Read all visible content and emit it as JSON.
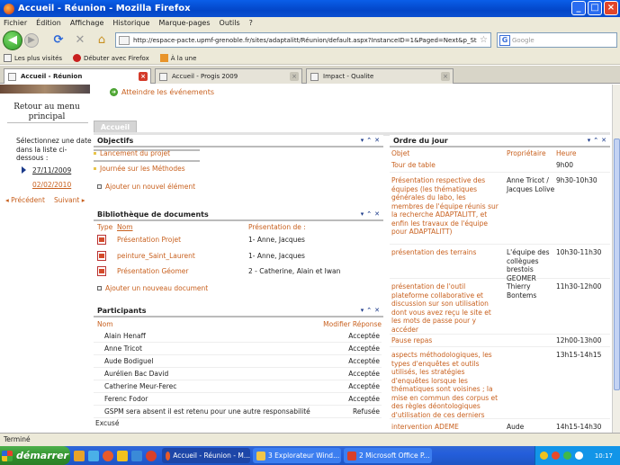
{
  "window": {
    "title": "Accueil - Réunion - Mozilla Firefox"
  },
  "menu": [
    "Fichier",
    "Édition",
    "Affichage",
    "Historique",
    "Marque-pages",
    "Outils",
    "?"
  ],
  "address": {
    "url": "http://espace-pacte.upmf-grenoble.fr/sites/adaptalitt/Réunion/default.aspx?InstanceID=1&Paged=Next&p_St",
    "search_placeholder": "Google"
  },
  "bookmarks": [
    "Les plus visités",
    "Débuter avec Firefox",
    "À la une"
  ],
  "tabs": [
    {
      "label": "Accueil - Réunion",
      "active": true
    },
    {
      "label": "Accueil - Progis 2009",
      "active": false
    },
    {
      "label": "Impact - Qualite",
      "active": false
    }
  ],
  "sidebar": {
    "menu_title": "Retour au menu principal",
    "instructions": "Sélectionnez une date dans la liste ci-dessous :",
    "dates": [
      "27/11/2009",
      "02/02/2010"
    ],
    "prev": "◂ Précédent",
    "next": "Suivant ▸"
  },
  "events_link": "Atteindre les événements",
  "page_tab": "Accueil",
  "objectifs": {
    "title": "Objectifs",
    "items": [
      "Lancement du projet",
      "Journée sur les Méthodes"
    ],
    "add": "Ajouter un nouvel élément"
  },
  "library": {
    "title": "Bibliothèque de documents",
    "col_type": "Type",
    "col_name": "Nom",
    "col_pres": "Présentation de :",
    "rows": [
      {
        "name": "Présentation Projet",
        "pres": "1- Anne, Jacques"
      },
      {
        "name": "peinture_Saint_Laurent",
        "pres": "1- Anne, Jacques"
      },
      {
        "name": "Présentation Géomer",
        "pres": "2 - Catherine, Alain et Iwan"
      }
    ],
    "add": "Ajouter un nouveau document"
  },
  "participants": {
    "title": "Participants",
    "col_name": "Nom",
    "col_resp": "Modifier Réponse",
    "rows": [
      {
        "name": "Alain Henaff",
        "resp": "Acceptée"
      },
      {
        "name": "Anne Tricot",
        "resp": "Acceptée"
      },
      {
        "name": "Aude Bodiguel",
        "resp": "Acceptée"
      },
      {
        "name": "Aurélien Bac David",
        "resp": "Acceptée"
      },
      {
        "name": "Catherine Meur-Ferec",
        "resp": "Acceptée"
      },
      {
        "name": "Ferenc Fodor",
        "resp": "Acceptée"
      },
      {
        "name": "GSPM sera absent il est retenu pour une autre responsabilité",
        "resp": "Refusée"
      }
    ],
    "group_excused": "Excusé"
  },
  "agenda": {
    "title": "Ordre du jour",
    "col_obj": "Objet",
    "col_owner": "Propriétaire",
    "col_hour": "Heure",
    "rows": [
      {
        "obj": "Tour de table",
        "owner": "",
        "hour": "9h00"
      },
      {
        "obj": "Présentation respective des équipes (les thématiques générales du labo, les membres de l'équipe réunis sur la recherche ADAPTALITT, et enfin les travaux de l'équipe pour ADAPTALITT)",
        "owner": "Anne Tricot / Jacques Lolive",
        "hour": "9h30-10h30"
      },
      {
        "obj": "présentation des terrains",
        "owner": "L'équipe des collègues brestois GEOMER",
        "hour": "10h30-11h30"
      },
      {
        "obj": "présentation de l'outil plateforme collaborative et discussion sur son utilisation dont vous avez reçu le site et les mots de passe pour y accéder",
        "owner": "Thierry Bontems",
        "hour": "11h30-12h00"
      },
      {
        "obj": "Pause repas",
        "owner": "",
        "hour": "12h00-13h00"
      },
      {
        "obj": "aspects méthodologiques, les types d'enquêtes et outils utilisés, les stratégies d'enquêtes lorsque les thématiques sont voisines ; la mise en commun des corpus et des règles déontologiques d'utilisation de ces derniers",
        "owner": "",
        "hour": "13h15-14h15"
      },
      {
        "obj": "intervention ADEME",
        "owner": "Aude",
        "hour": "14h15-14h30"
      }
    ]
  },
  "status": "Terminé",
  "taskbar": {
    "start": "démarrer",
    "tasks": [
      "Accueil - Réunion - M...",
      "3 Explorateur Wind...",
      "2 Microsoft Office P..."
    ],
    "clock": "10:17"
  }
}
